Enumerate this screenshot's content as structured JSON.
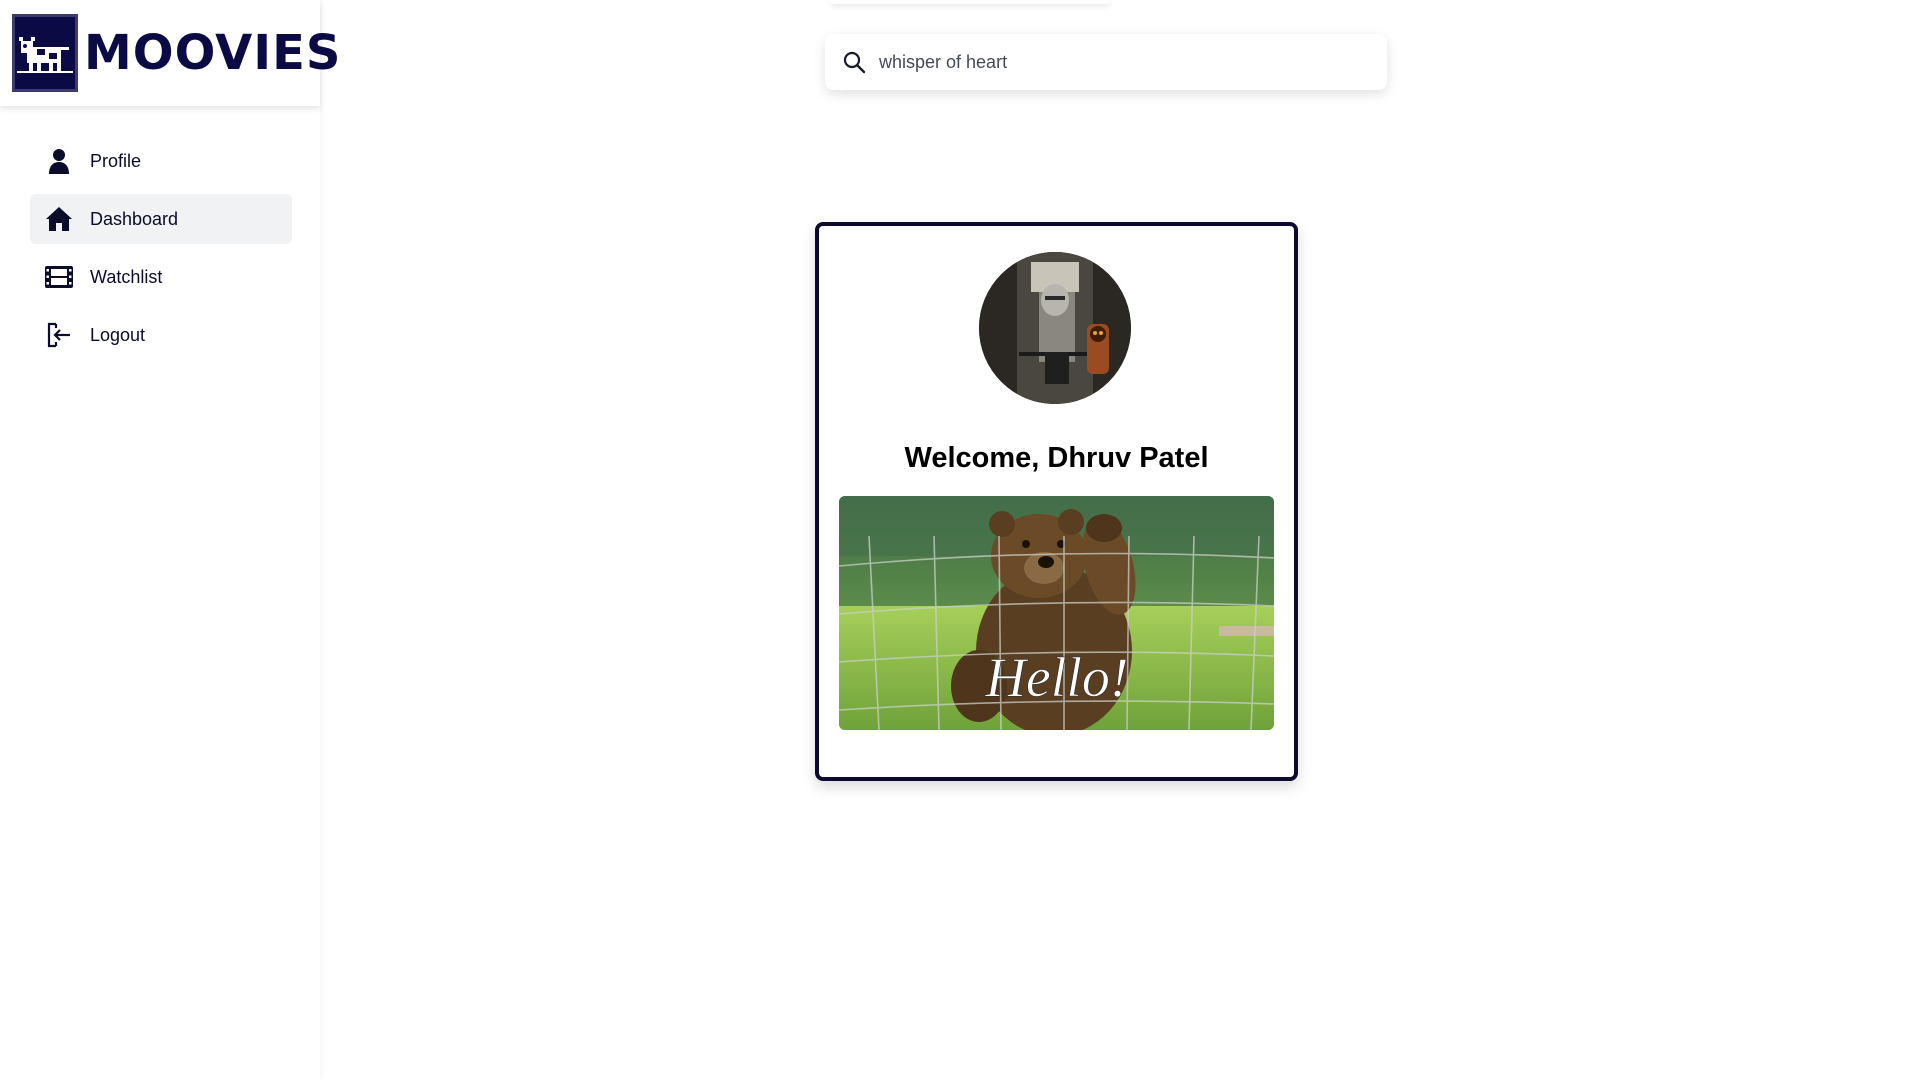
{
  "brand": {
    "name": "MOOVIES",
    "logo_icon": "cow-icon"
  },
  "sidebar": {
    "items": [
      {
        "label": "Profile",
        "icon": "user-icon",
        "active": false
      },
      {
        "label": "Dashboard",
        "icon": "home-icon",
        "active": true
      },
      {
        "label": "Watchlist",
        "icon": "film-icon",
        "active": false
      },
      {
        "label": "Logout",
        "icon": "logout-icon",
        "active": false
      }
    ]
  },
  "search": {
    "value": "whisper of heart",
    "icon": "search-icon"
  },
  "card": {
    "welcome_text": "Welcome, Dhruv Patel",
    "gif_caption": "Hello!"
  },
  "colors": {
    "brand": "#0c0a45",
    "active_nav_bg": "#f1f2f4",
    "card_border": "#0c0a2e"
  }
}
